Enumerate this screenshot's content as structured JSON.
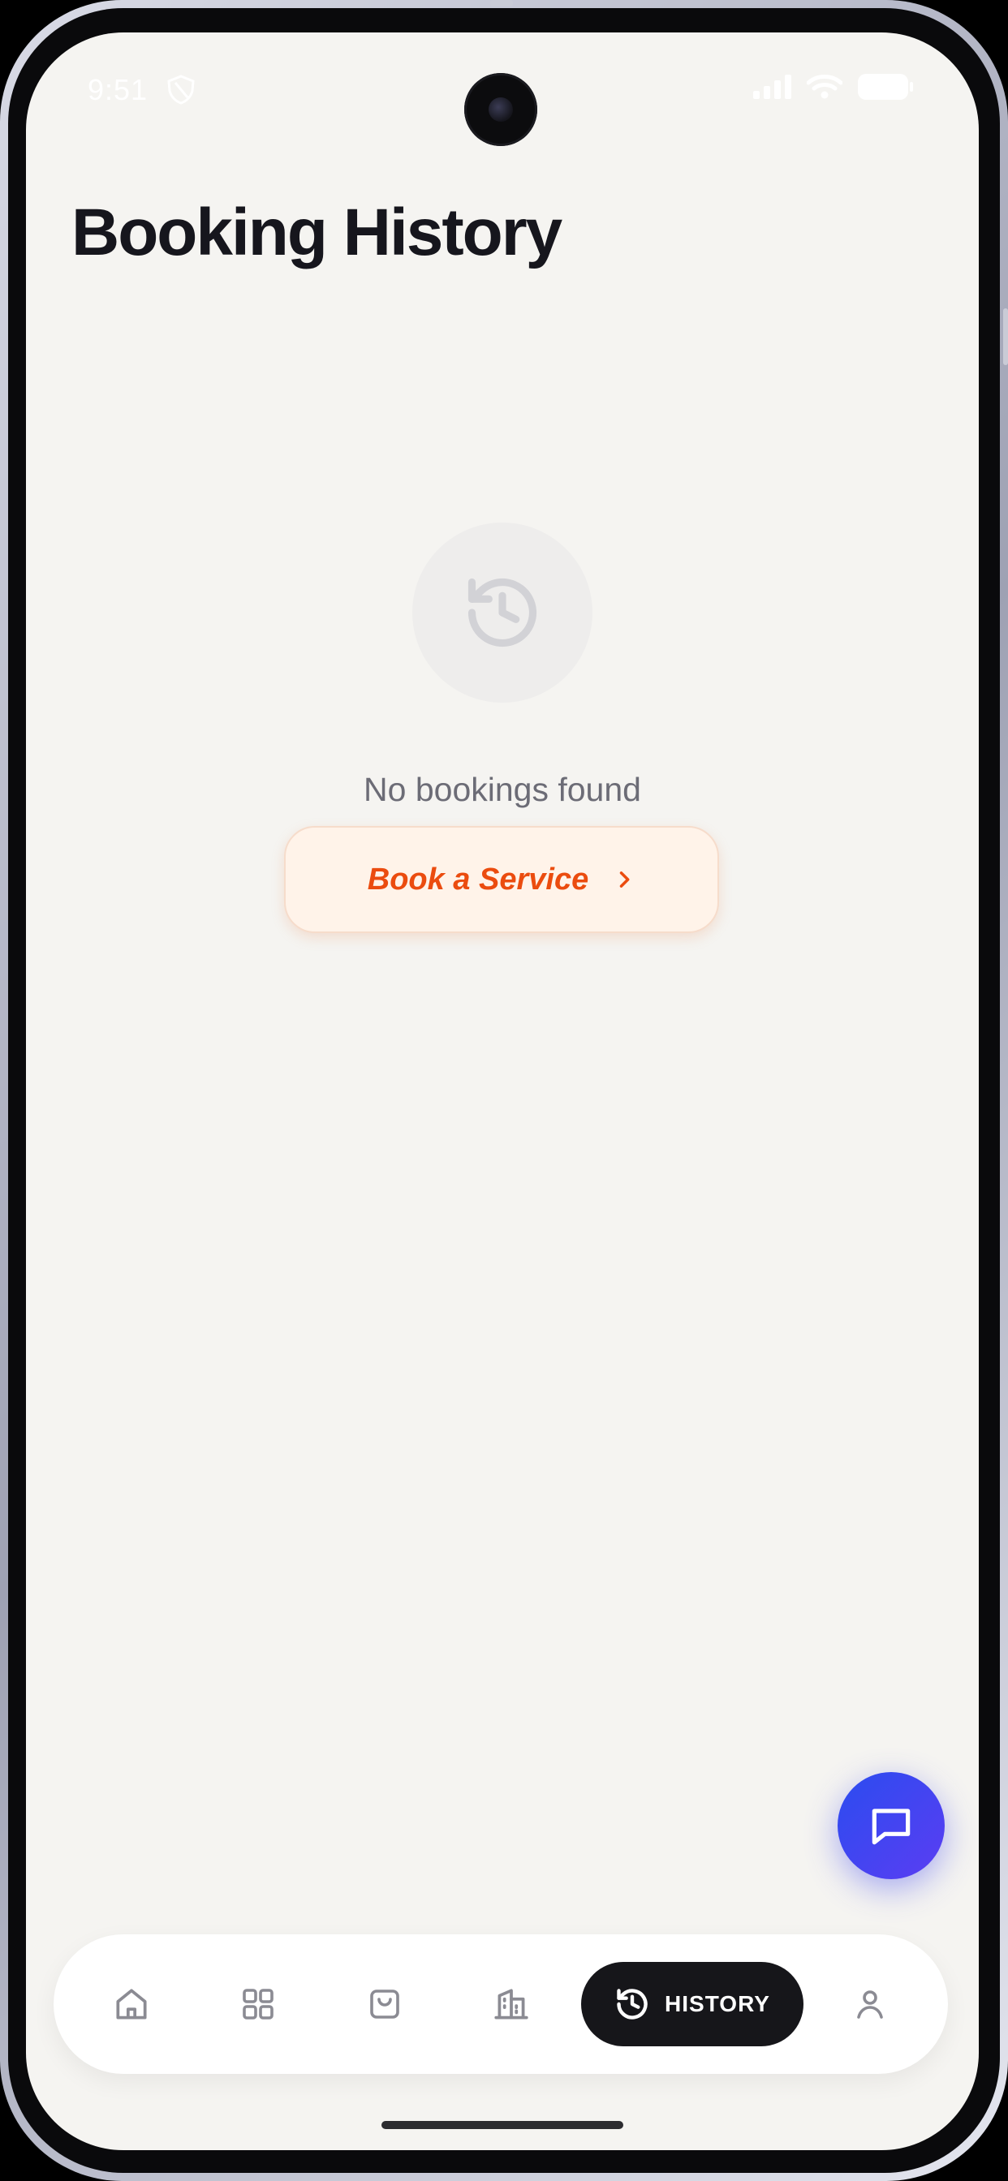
{
  "status_bar": {
    "time": "9:51"
  },
  "page": {
    "title": "Booking History"
  },
  "empty_state": {
    "message": "No bookings found",
    "cta_label": "Book a Service"
  },
  "bottom_nav": {
    "items": [
      {
        "name": "home",
        "icon": "home-icon"
      },
      {
        "name": "categories",
        "icon": "grid-icon"
      },
      {
        "name": "shop",
        "icon": "shopping-bag-icon"
      },
      {
        "name": "companies",
        "icon": "building-icon"
      },
      {
        "name": "history",
        "icon": "history-icon",
        "label": "HISTORY",
        "active": true
      },
      {
        "name": "profile",
        "icon": "user-icon"
      }
    ]
  },
  "colors": {
    "background": "#f5f4f1",
    "accent": "#eb4c0f",
    "cta_bg": "#fff3e9",
    "active_nav_bg": "#16161a",
    "chat_fab": "#3b46f1"
  }
}
